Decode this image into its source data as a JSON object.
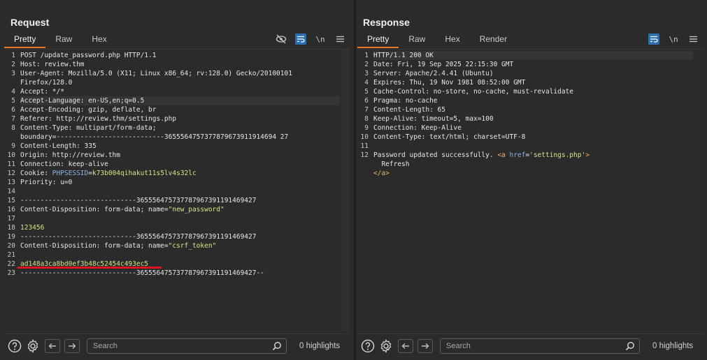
{
  "request": {
    "title": "Request",
    "tabs": [
      "Pretty",
      "Raw",
      "Hex"
    ],
    "lines": [
      {
        "n": "1",
        "parts": [
          [
            "k",
            "POST /update_password.php HTTP/1.1"
          ]
        ]
      },
      {
        "n": "2",
        "parts": [
          [
            "k",
            "Host: "
          ],
          [
            "k",
            "review.thm"
          ]
        ]
      },
      {
        "n": "3",
        "parts": [
          [
            "k",
            "User-Agent: "
          ],
          [
            "k",
            "Mozilla/5.0 (X11; Linux x86_64; rv:128.0) Gecko/20100101"
          ]
        ]
      },
      {
        "n": "",
        "parts": [
          [
            "k",
            "Firefox/128.0"
          ]
        ]
      },
      {
        "n": "4",
        "parts": [
          [
            "k",
            "Accept: "
          ],
          [
            "k",
            "*/*"
          ]
        ]
      },
      {
        "n": "5",
        "hl": true,
        "parts": [
          [
            "k",
            "Accept-Language: "
          ],
          [
            "k",
            "en-US,en;q=0.5"
          ]
        ]
      },
      {
        "n": "6",
        "parts": [
          [
            "k",
            "Accept-Encoding: "
          ],
          [
            "k",
            "gzip, deflate, br"
          ]
        ]
      },
      {
        "n": "7",
        "parts": [
          [
            "k",
            "Referer: "
          ],
          [
            "k",
            "http://review.thm/settings.php"
          ]
        ]
      },
      {
        "n": "8",
        "parts": [
          [
            "k",
            "Content-Type: "
          ],
          [
            "k",
            "multipart/form-data;"
          ]
        ]
      },
      {
        "n": "",
        "parts": [
          [
            "k",
            "boundary=---------------------------3655564757377879673911914694 27"
          ]
        ]
      },
      {
        "n": "9",
        "parts": [
          [
            "k",
            "Content-Length: "
          ],
          [
            "k",
            "335"
          ]
        ]
      },
      {
        "n": "10",
        "parts": [
          [
            "k",
            "Origin: "
          ],
          [
            "k",
            "http://review.thm"
          ]
        ]
      },
      {
        "n": "11",
        "parts": [
          [
            "k",
            "Connection: "
          ],
          [
            "k",
            "keep-alive"
          ]
        ]
      },
      {
        "n": "12",
        "parts": [
          [
            "k",
            "Cookie: "
          ],
          [
            "s",
            "PHPSESSID"
          ],
          [
            "k",
            "="
          ],
          [
            "g",
            "k73b004qihakut11s5lv4s32lc"
          ]
        ]
      },
      {
        "n": "13",
        "parts": [
          [
            "k",
            "Priority: "
          ],
          [
            "k",
            "u=0"
          ]
        ]
      },
      {
        "n": "14",
        "parts": [
          [
            "k",
            ""
          ]
        ]
      },
      {
        "n": "15",
        "parts": [
          [
            "k",
            "-----------------------------365556475737787967391191469427"
          ]
        ]
      },
      {
        "n": "16",
        "parts": [
          [
            "k",
            "Content-Disposition: form-data; name="
          ],
          [
            "g",
            "\"new_password\""
          ]
        ]
      },
      {
        "n": "17",
        "parts": [
          [
            "k",
            ""
          ]
        ]
      },
      {
        "n": "18",
        "parts": [
          [
            "g",
            "123456"
          ]
        ]
      },
      {
        "n": "19",
        "parts": [
          [
            "k",
            "-----------------------------365556475737787967391191469427"
          ]
        ]
      },
      {
        "n": "20",
        "parts": [
          [
            "k",
            "Content-Disposition: form-data; name="
          ],
          [
            "g",
            "\"csrf_token\""
          ]
        ]
      },
      {
        "n": "21",
        "parts": [
          [
            "k",
            ""
          ]
        ]
      },
      {
        "n": "22",
        "parts": [
          [
            "g",
            "ad148a3ca8bd0ef3b48c52454c493ec5"
          ]
        ]
      },
      {
        "n": "23",
        "parts": [
          [
            "k",
            "-----------------------------365556475737787967391191469427--"
          ]
        ]
      }
    ],
    "search_placeholder": "Search",
    "highlights": "0 highlights"
  },
  "response": {
    "title": "Response",
    "tabs": [
      "Pretty",
      "Raw",
      "Hex",
      "Render"
    ],
    "lines": [
      {
        "n": "1",
        "hl": true,
        "parts": [
          [
            "k",
            "HTTP/1.1 200 OK"
          ]
        ]
      },
      {
        "n": "2",
        "parts": [
          [
            "k",
            "Date: "
          ],
          [
            "k",
            "Fri, 19 Sep 2025 22:15:30 GMT"
          ]
        ]
      },
      {
        "n": "3",
        "parts": [
          [
            "k",
            "Server: "
          ],
          [
            "k",
            "Apache/2.4.41 (Ubuntu)"
          ]
        ]
      },
      {
        "n": "4",
        "parts": [
          [
            "k",
            "Expires: "
          ],
          [
            "k",
            "Thu, 19 Nov 1981 08:52:00 GMT"
          ]
        ]
      },
      {
        "n": "5",
        "parts": [
          [
            "k",
            "Cache-Control: "
          ],
          [
            "k",
            "no-store, no-cache, must-revalidate"
          ]
        ]
      },
      {
        "n": "6",
        "parts": [
          [
            "k",
            "Pragma: "
          ],
          [
            "k",
            "no-cache"
          ]
        ]
      },
      {
        "n": "7",
        "parts": [
          [
            "k",
            "Content-Length: "
          ],
          [
            "k",
            "65"
          ]
        ]
      },
      {
        "n": "8",
        "parts": [
          [
            "k",
            "Keep-Alive: "
          ],
          [
            "k",
            "timeout=5, max=100"
          ]
        ]
      },
      {
        "n": "9",
        "parts": [
          [
            "k",
            "Connection: "
          ],
          [
            "k",
            "Keep-Alive"
          ]
        ]
      },
      {
        "n": "10",
        "parts": [
          [
            "k",
            "Content-Type: "
          ],
          [
            "k",
            "text/html; charset=UTF-8"
          ]
        ]
      },
      {
        "n": "11",
        "parts": [
          [
            "k",
            ""
          ]
        ]
      },
      {
        "n": "12",
        "parts": [
          [
            "k",
            "Password updated successfully. "
          ],
          [
            "a",
            "<a "
          ],
          [
            "s",
            "href"
          ],
          [
            "k",
            "="
          ],
          [
            "g",
            "'settings.php'"
          ],
          [
            "a",
            ">"
          ]
        ]
      },
      {
        "n": "",
        "parts": [
          [
            "k",
            "  Refresh"
          ]
        ]
      },
      {
        "n": "",
        "parts": [
          [
            "a",
            "</a>"
          ]
        ]
      }
    ],
    "search_placeholder": "Search",
    "highlights": "0 highlights"
  },
  "colors": {
    "accent": "#e8782a",
    "toggle_on": "#2d6fb3",
    "annotation": "#e0141e"
  }
}
